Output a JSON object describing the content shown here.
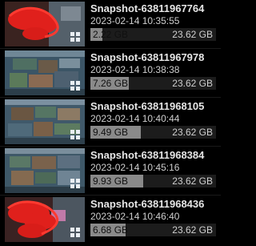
{
  "snapshots": [
    {
      "name": "Snapshot-63811967764",
      "date": "2023-02-14 10:35:55",
      "used": "2.22 GB",
      "total": "23.62 GB",
      "fraction": 0.094,
      "thumbnail": "redacted-thumbnail"
    },
    {
      "name": "Snapshot-63811967978",
      "date": "2023-02-14 10:38:38",
      "used": "7.26 GB",
      "total": "23.62 GB",
      "fraction": 0.307,
      "thumbnail": "desktop-thumbnail"
    },
    {
      "name": "Snapshot-63811968105",
      "date": "2023-02-14 10:40:44",
      "used": "9.49 GB",
      "total": "23.62 GB",
      "fraction": 0.402,
      "thumbnail": "desktop-thumbnail"
    },
    {
      "name": "Snapshot-63811968384",
      "date": "2023-02-14 10:45:16",
      "used": "9.93 GB",
      "total": "23.62 GB",
      "fraction": 0.42,
      "thumbnail": "desktop-thumbnail"
    },
    {
      "name": "Snapshot-63811968436",
      "date": "2023-02-14 10:46:40",
      "used": "6.68 GB",
      "total": "23.62 GB",
      "fraction": 0.283,
      "thumbnail": "redacted-thumbnail"
    }
  ],
  "colors": {
    "background": "#000000",
    "bar_fill": "#8a8a8a",
    "bar_track": "#1c1c1c",
    "redaction": "#e0201c"
  }
}
